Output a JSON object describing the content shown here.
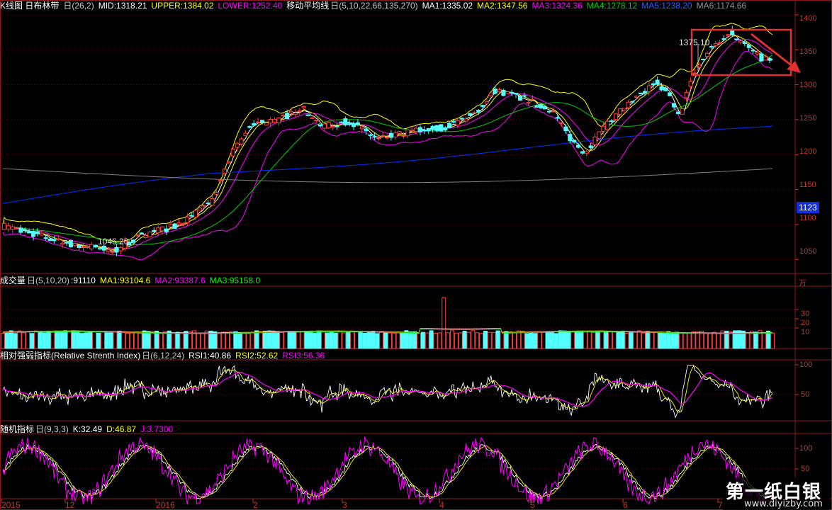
{
  "colors": {
    "up": "#ff4040",
    "down": "#54ffff",
    "mid": "#ffffff",
    "upper": "#ffff00",
    "lower": "#ff00ff",
    "ma1": "#ffffff",
    "ma2": "#ffff00",
    "ma3": "#ff00ff",
    "ma4": "#00cc00",
    "ma5": "#0033ff",
    "ma6": "#808080",
    "axis": "#c0392b",
    "annotation_box": "#e03030"
  },
  "main_panel": {
    "title": "K线图 日布林带",
    "params": "日(26,2)",
    "mid": "MID:1318.21",
    "upper": "UPPER:1384.02",
    "lower": "LOWER:1252.40",
    "ma_title": "移动平均线",
    "ma_params": "日(5,10,22,66,135,270)",
    "ma1": "MA1:1335.02",
    "ma2": "MA2:1347.56",
    "ma3": "MA3:1324.36",
    "ma4": "MA4:1278.12",
    "ma5": "MA5:1238.20",
    "ma6": "MA6:1174.66",
    "y_ticks": [
      "1400",
      "1350",
      "1300",
      "1250",
      "1200",
      "1150",
      "1100",
      "1050"
    ],
    "current_price_badge": "1123",
    "high_label": "1375.10",
    "low_label": "1046.20"
  },
  "volume_panel": {
    "title": "成交量",
    "params": "日(5,10,20)",
    "vol": ":91110",
    "ma1": "MA1:93104.6",
    "ma2": "MA2:93387.6",
    "ma3": "MA3:95158.0",
    "unit": "万",
    "y_ticks": [
      "30",
      "20",
      "10"
    ]
  },
  "rsi_panel": {
    "title": "相对强弱指标(Relative Strenth Index)",
    "params": "日(6,12,24)",
    "rsi1": "RSI1:40.86",
    "rsi2": "RSI2:52.62",
    "rsi3": "RSI3:56.36",
    "y_ticks": [
      "100",
      "50"
    ]
  },
  "kdj_panel": {
    "title": "随机指标",
    "params": "日(9,3,3)",
    "k": "K:32.49",
    "d": "D:46.87",
    "j": "J:3.7300",
    "y_ticks": [
      "100",
      "50"
    ]
  },
  "x_axis": {
    "labels": [
      "2015",
      "12",
      "2016",
      "2",
      "3",
      "4",
      "5",
      "6",
      "7"
    ]
  },
  "watermark": {
    "title": "第一纸白银",
    "url": "www.diyizby.com"
  },
  "chart_data": {
    "type": "line",
    "series_note": "",
    "x": [],
    "y_range_price": [
      1030,
      1405
    ],
    "close_anchor_points": [
      [
        0,
        1098
      ],
      [
        25,
        1085
      ],
      [
        50,
        1072
      ],
      [
        80,
        1062
      ],
      [
        100,
        1085
      ],
      [
        125,
        1098
      ],
      [
        150,
        1130
      ],
      [
        165,
        1200
      ],
      [
        180,
        1245
      ],
      [
        200,
        1250
      ],
      [
        215,
        1268
      ],
      [
        230,
        1240
      ],
      [
        250,
        1248
      ],
      [
        270,
        1222
      ],
      [
        285,
        1228
      ],
      [
        300,
        1235
      ],
      [
        320,
        1240
      ],
      [
        340,
        1258
      ],
      [
        355,
        1292
      ],
      [
        375,
        1280
      ],
      [
        395,
        1265
      ],
      [
        410,
        1220
      ],
      [
        420,
        1203
      ],
      [
        430,
        1230
      ],
      [
        445,
        1262
      ],
      [
        460,
        1285
      ],
      [
        472,
        1305
      ],
      [
        480,
        1285
      ],
      [
        488,
        1252
      ],
      [
        495,
        1300
      ],
      [
        505,
        1340
      ],
      [
        515,
        1362
      ],
      [
        525,
        1375
      ],
      [
        535,
        1356
      ],
      [
        545,
        1340
      ],
      [
        555,
        1333
      ]
    ],
    "volume_range": [
      0,
      35
    ],
    "volume_spike": {
      "index": 318,
      "value": 30.5
    },
    "rsi_range": [
      0,
      100
    ],
    "kdj_range": [
      0,
      120
    ]
  }
}
